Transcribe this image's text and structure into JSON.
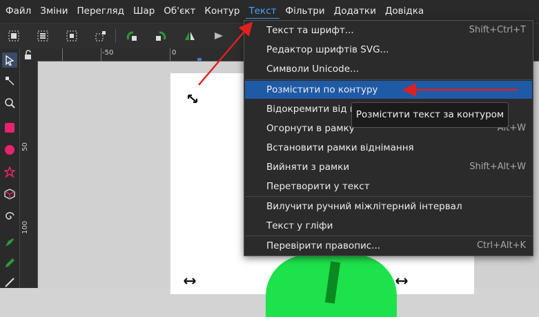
{
  "menubar": {
    "items": [
      "Файл",
      "Зміни",
      "Перегляд",
      "Шар",
      "Об'єкт",
      "Контур",
      "Текст",
      "Фільтри",
      "Додатки",
      "Довідка"
    ],
    "active_index": 6
  },
  "ruler": {
    "h_labels": [
      "-50",
      "0"
    ]
  },
  "vruler": {
    "labels": [
      "50",
      "100"
    ]
  },
  "text_menu": {
    "items": [
      {
        "label": "Текст та шрифт...",
        "shortcut": "Shift+Ctrl+T"
      },
      {
        "label": "Редактор шрифтів SVG...",
        "shortcut": ""
      },
      {
        "label": "Символи Unicode...",
        "shortcut": ""
      },
      {
        "label": "Розмістити по контуру",
        "shortcut": ""
      },
      {
        "label": "Відокремити від контуру",
        "shortcut": ""
      },
      {
        "label": "Огорнути в рамку",
        "shortcut": "Alt+W"
      },
      {
        "label": "Встановити рамки віднімання",
        "shortcut": ""
      },
      {
        "label": "Вийняти з рамки",
        "shortcut": "Shift+Alt+W"
      },
      {
        "label": "Перетворити у текст",
        "shortcut": ""
      },
      {
        "label": "Вилучити ручний міжлітерний інтервал",
        "shortcut": ""
      },
      {
        "label": "Текст у гліфи",
        "shortcut": ""
      },
      {
        "label": "Перевірити правопис...",
        "shortcut": "Ctrl+Alt+K"
      }
    ],
    "highlighted_index": 3
  },
  "tooltip": {
    "text": "Розмістити текст за контуром"
  },
  "colors": {
    "accent": "#4aa3ff",
    "highlight": "#1f5aa6",
    "arrow": "#e02020",
    "leaf": "#1ee24c"
  }
}
